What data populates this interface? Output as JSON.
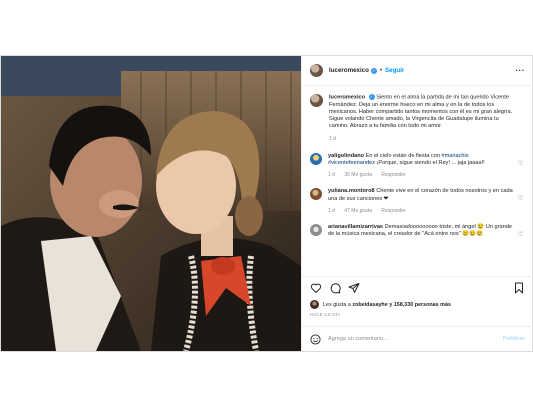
{
  "post": {
    "author": "luceromexico",
    "follow_label": "Seguir",
    "more_label": "···",
    "caption": {
      "author": "luceromexico",
      "text": "Siento en el alma la partida de mi tan querido Vicente Fernández. Deja un enorme hueco en mi alma y en la de todos los mexicanos. Haber compartido tantos momentos con él es mi gran alegría. Sigue volando Chente amado, la Virgencita de Guadalupe ilumina tu camino. Abrazo a tu familia con todo mi amor.",
      "age": "1 d"
    },
    "comments": [
      {
        "author": "yaligolindano",
        "text_before": "En el cielo están de fiesta con ",
        "hashtags": "#mariachis #vicentefeenandez",
        "text_after": " ¡Porque, sigue siendo el Rey! ... jaja jaaaa!!",
        "age": "1 d",
        "likes": "36 Me gusta",
        "reply": "Responder"
      },
      {
        "author": "yuliana.montoro8",
        "text": "Chente vive en el corazón de todos nosotros y en cada una de sus canciones ❤",
        "age": "1 d",
        "likes": "47 Me gusta",
        "reply": "Responder"
      },
      {
        "author": "arianavillamizarrivas",
        "text": "Demasiadooooooooo triste, mi ángel 😢 Un grande de la música mexicana, el creador de \"Acá entre nos\" 😢😢😢",
        "age": "",
        "likes": "",
        "reply": ""
      }
    ],
    "likes_text_prefix": "Les gusta a ",
    "likes_user": "zobeidasayhe",
    "likes_text_suffix": " y 158,330 personas más",
    "time_ago": "HACE UN DÍA",
    "comment_placeholder": "Agrega un comentario...",
    "publish_label": "Publicar"
  },
  "colors": {
    "link_blue": "#0095f6",
    "publish_disabled": "#b2dffc",
    "hashtag": "#00376b",
    "muted": "#8e8e8e"
  },
  "icons": [
    "more-options-icon",
    "verified-badge-icon",
    "heart-icon",
    "comment-icon",
    "share-icon",
    "bookmark-icon",
    "emoji-icon"
  ]
}
